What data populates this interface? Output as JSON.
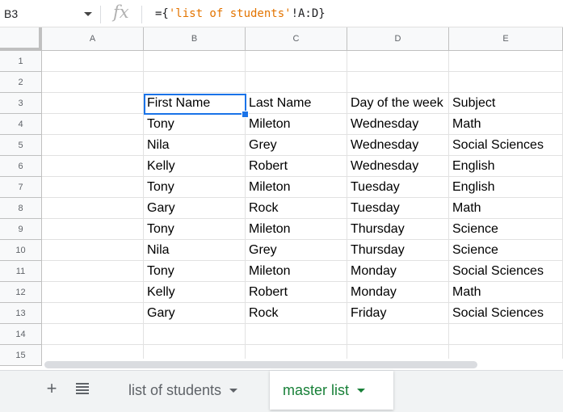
{
  "formula_bar": {
    "name_box": "B3",
    "fx_label": "fx",
    "formula_prefix": "={",
    "formula_string": "'list of students'",
    "formula_suffix": "!A:D}"
  },
  "columns": [
    "A",
    "B",
    "C",
    "D",
    "E"
  ],
  "rows": [
    "1",
    "2",
    "3",
    "4",
    "5",
    "6",
    "7",
    "8",
    "9",
    "10",
    "11",
    "12",
    "13",
    "14",
    "15"
  ],
  "table": {
    "header": [
      "First Name",
      "Last Name",
      "Day of the week",
      "Subject"
    ],
    "rows": [
      [
        "Tony",
        "Mileton",
        "Wednesday",
        "Math"
      ],
      [
        "Nila",
        "Grey",
        "Wednesday",
        "Social Sciences"
      ],
      [
        "Kelly",
        "Robert",
        "Wednesday",
        "English"
      ],
      [
        "Tony",
        "Mileton",
        "Tuesday",
        "English"
      ],
      [
        "Gary",
        "Rock",
        "Tuesday",
        "Math"
      ],
      [
        "Tony",
        "Mileton",
        "Thursday",
        "Science"
      ],
      [
        "Nila",
        "Grey",
        "Thursday",
        "Science"
      ],
      [
        "Tony",
        "Mileton",
        "Monday",
        "Social Sciences"
      ],
      [
        "Kelly",
        "Robert",
        "Monday",
        "Math"
      ],
      [
        "Gary",
        "Rock",
        "Friday",
        "Social Sciences"
      ]
    ]
  },
  "sheet_tabs": [
    {
      "label": "list of students",
      "active": false
    },
    {
      "label": "master list",
      "active": true
    }
  ],
  "icons": {
    "add_sheet": "plus-icon",
    "all_sheets": "menu-list-icon"
  },
  "colors": {
    "selection": "#1a73e8",
    "active_tab": "#188038",
    "formula_string": "#e37400"
  }
}
